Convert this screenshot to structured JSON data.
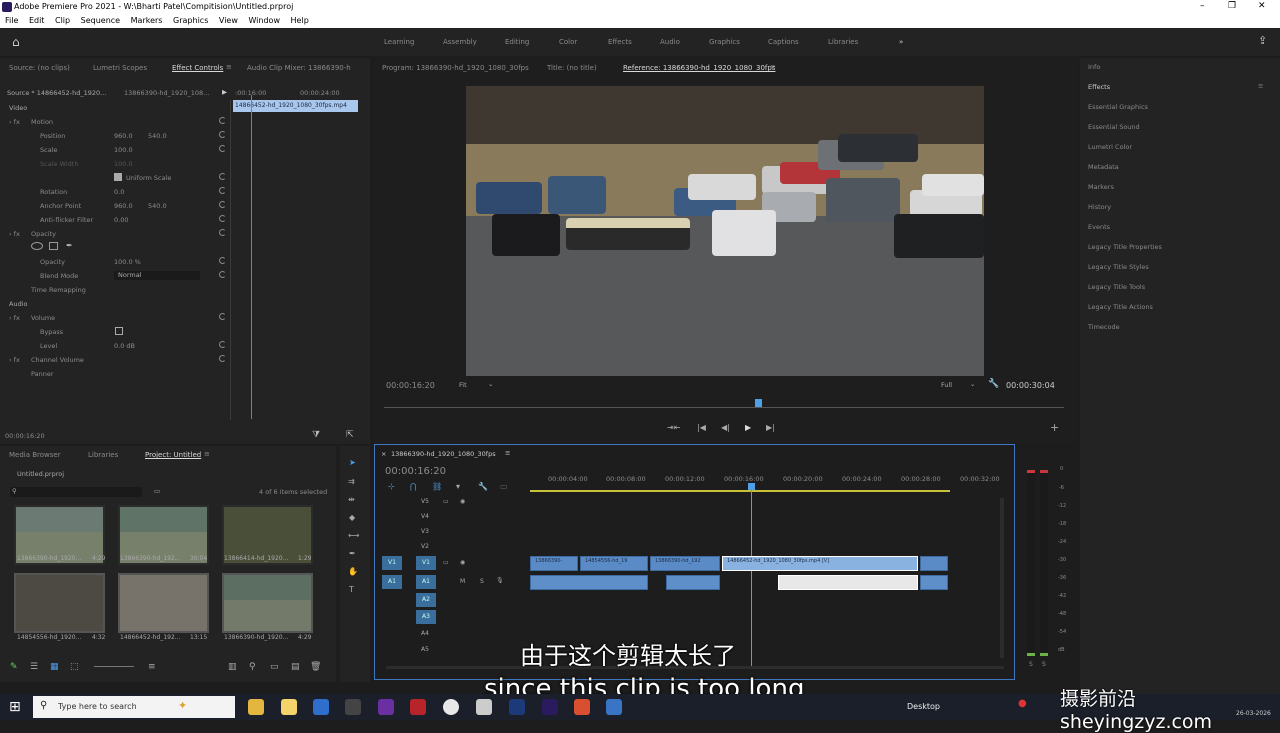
{
  "app": {
    "title": "Adobe Premiere Pro 2021 - W:\\Bharti Patel\\Compitision\\Untitled.prproj"
  },
  "menu": [
    "File",
    "Edit",
    "Clip",
    "Sequence",
    "Markers",
    "Graphics",
    "View",
    "Window",
    "Help"
  ],
  "workspaces": [
    "Learning",
    "Assembly",
    "Editing",
    "Color",
    "Effects",
    "Audio",
    "Graphics",
    "Captions",
    "Libraries"
  ],
  "left_tabs": {
    "source": "Source: (no clips)",
    "lumetri": "Lumetri Scopes",
    "effect_controls": "Effect Controls",
    "audio_mixer": "Audio Clip Mixer: 13866390-h"
  },
  "effect_controls": {
    "source_label": "Source * 14866452-hd_1920...",
    "seq_label": "13866390-hd_1920_108...",
    "ruler_start": ":00:16:00",
    "ruler_end": "00:00:24:00",
    "clip_name": "14866452-hd_1920_1080_30fps.mp4",
    "video_header": "Video",
    "motion": "Motion",
    "params": [
      {
        "name": "Position",
        "v1": "960.0",
        "v2": "540.0"
      },
      {
        "name": "Scale",
        "v1": "100.0",
        "v2": ""
      },
      {
        "name": "Scale Width",
        "v1": "100.0",
        "v2": ""
      },
      {
        "name": "Uniform Scale",
        "v1": "",
        "v2": ""
      },
      {
        "name": "Rotation",
        "v1": "0.0",
        "v2": ""
      },
      {
        "name": "Anchor Point",
        "v1": "960.0",
        "v2": "540.0"
      },
      {
        "name": "Anti-flicker Filter",
        "v1": "0.00",
        "v2": ""
      }
    ],
    "opacity": "Opacity",
    "opacity_value": "100.0 %",
    "blend_mode": "Blend Mode",
    "blend_value": "Normal",
    "time_remap": "Time Remapping",
    "audio_header": "Audio",
    "volume": "Volume",
    "bypass": "Bypass",
    "level": "Level",
    "level_value": "0.0 dB",
    "channel_volume": "Channel Volume",
    "panner": "Panner",
    "timecode": "00:00:16:20"
  },
  "program_tabs": {
    "program": "Program: 13866390-hd_1920_1080_30fps",
    "title": "Title: (no title)",
    "reference": "Reference: 13866390-hd_1920_1080_30fps"
  },
  "monitor": {
    "timecode": "00:00:16:20",
    "fit": "Fit",
    "quality": "Full",
    "duration": "00:00:30:04"
  },
  "right_panel": {
    "info": "Info",
    "effects": "Effects",
    "items": [
      "Essential Graphics",
      "Essential Sound",
      "Lumetri Color",
      "Metadata",
      "Markers",
      "History",
      "Events",
      "Legacy Title Properties",
      "Legacy Title Styles",
      "Legacy Title Tools",
      "Legacy Title Actions",
      "Timecode"
    ]
  },
  "project": {
    "tabs": [
      "Media Browser",
      "Libraries",
      "Project: Untitled"
    ],
    "file": "Untitled.prproj",
    "count": "4 of 6 items selected",
    "items": [
      {
        "name": "13866390-hd_1920...",
        "dur": "4:29"
      },
      {
        "name": "13866390-hd_192...",
        "dur": "30:04"
      },
      {
        "name": "13866414-hd_1920...",
        "dur": "1:29"
      },
      {
        "name": "14854556-hd_1920...",
        "dur": "4:32"
      },
      {
        "name": "14866452-hd_192...",
        "dur": "13:15"
      },
      {
        "name": "13866390-hd_1920...",
        "dur": "4:29"
      }
    ]
  },
  "timeline": {
    "seq_name": "13866390-hd_1920_1080_30fps",
    "timecode": "00:00:16:20",
    "ruler": [
      "00:00:04:00",
      "00:00:08:00",
      "00:00:12:00",
      "00:00:16:00",
      "00:00:20:00",
      "00:00:24:00",
      "00:00:28:00",
      "00:00:32:00"
    ],
    "video_tracks": [
      "V5",
      "V4",
      "V3",
      "V2",
      "V1"
    ],
    "audio_tracks": [
      "A1",
      "A2",
      "A3",
      "A4",
      "A5"
    ],
    "clips": [
      "13866390-",
      "14854556-hd_19",
      "13866390-hd_192",
      "14866452-hd_1920_1080_30fps.mp4 [V]",
      ""
    ]
  },
  "meter_scale": [
    "0",
    "-6",
    "-12",
    "-18",
    "-24",
    "-30",
    "-36",
    "-42",
    "-48",
    "-54",
    "dB"
  ],
  "meter_footer": [
    "S",
    "S"
  ],
  "subtitles": {
    "chinese": "由于这个剪辑太长了",
    "english": "since this clip is too long"
  },
  "watermark": "摄影前沿 sheyingzyz.com",
  "taskbar": {
    "search": "Type here to search",
    "desktop": "Desktop",
    "date": "26-03-2026"
  }
}
